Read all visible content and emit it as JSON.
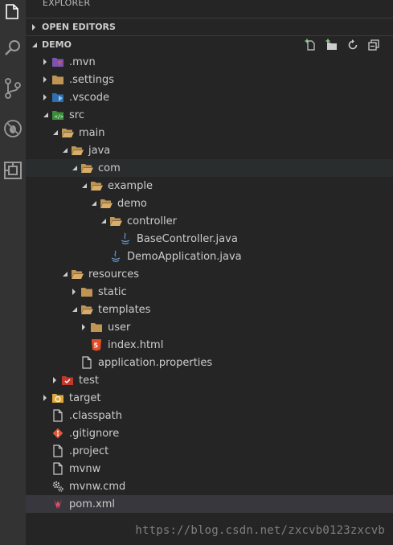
{
  "explorer": {
    "title": "EXPLORER"
  },
  "sections": {
    "open_editors": "OPEN EDITORS",
    "project": "DEMO"
  },
  "tree": [
    {
      "label": ".mvn",
      "depth": 0,
      "twisty": "collapsed",
      "icon": "folder-mvn-icon"
    },
    {
      "label": ".settings",
      "depth": 0,
      "twisty": "collapsed",
      "icon": "folder-icon"
    },
    {
      "label": ".vscode",
      "depth": 0,
      "twisty": "collapsed",
      "icon": "folder-vscode-icon"
    },
    {
      "label": "src",
      "depth": 0,
      "twisty": "expanded",
      "icon": "folder-src-icon"
    },
    {
      "label": "main",
      "depth": 1,
      "twisty": "expanded",
      "icon": "folder-open-icon"
    },
    {
      "label": "java",
      "depth": 2,
      "twisty": "expanded",
      "icon": "folder-open-icon"
    },
    {
      "label": "com",
      "depth": 3,
      "twisty": "expanded",
      "icon": "folder-open-icon",
      "state": "hover"
    },
    {
      "label": "example",
      "depth": 4,
      "twisty": "expanded",
      "icon": "folder-open-icon"
    },
    {
      "label": "demo",
      "depth": 5,
      "twisty": "expanded",
      "icon": "folder-open-icon"
    },
    {
      "label": "controller",
      "depth": 6,
      "twisty": "expanded",
      "icon": "folder-open-icon"
    },
    {
      "label": "BaseController.java",
      "depth": 7,
      "twisty": "none",
      "icon": "java-file-icon"
    },
    {
      "label": "DemoApplication.java",
      "depth": 6,
      "twisty": "none",
      "icon": "java-file-icon"
    },
    {
      "label": "resources",
      "depth": 2,
      "twisty": "expanded",
      "icon": "folder-open-icon"
    },
    {
      "label": "static",
      "depth": 3,
      "twisty": "collapsed",
      "icon": "folder-icon"
    },
    {
      "label": "templates",
      "depth": 3,
      "twisty": "expanded",
      "icon": "folder-open-icon"
    },
    {
      "label": "user",
      "depth": 4,
      "twisty": "collapsed",
      "icon": "folder-icon"
    },
    {
      "label": "index.html",
      "depth": 4,
      "twisty": "none",
      "icon": "html5-file-icon"
    },
    {
      "label": "application.properties",
      "depth": 3,
      "twisty": "none",
      "icon": "file-icon"
    },
    {
      "label": "test",
      "depth": 1,
      "twisty": "collapsed",
      "icon": "folder-test-icon"
    },
    {
      "label": "target",
      "depth": 0,
      "twisty": "collapsed",
      "icon": "folder-target-icon"
    },
    {
      "label": ".classpath",
      "depth": 0,
      "twisty": "none",
      "icon": "file-icon"
    },
    {
      "label": ".gitignore",
      "depth": 0,
      "twisty": "none",
      "icon": "git-file-icon"
    },
    {
      "label": ".project",
      "depth": 0,
      "twisty": "none",
      "icon": "file-icon"
    },
    {
      "label": "mvnw",
      "depth": 0,
      "twisty": "none",
      "icon": "file-icon"
    },
    {
      "label": "mvnw.cmd",
      "depth": 0,
      "twisty": "none",
      "icon": "gears-file-icon"
    },
    {
      "label": "pom.xml",
      "depth": 0,
      "twisty": "none",
      "icon": "maven-file-icon",
      "state": "selected"
    }
  ],
  "watermark": "https://blog.csdn.net/zxcvb0123zxcvb",
  "colors": {
    "sidebar_bg": "#252526",
    "activity_bar_bg": "#333333",
    "folder": "#c09553",
    "selected_row": "#37373d"
  }
}
